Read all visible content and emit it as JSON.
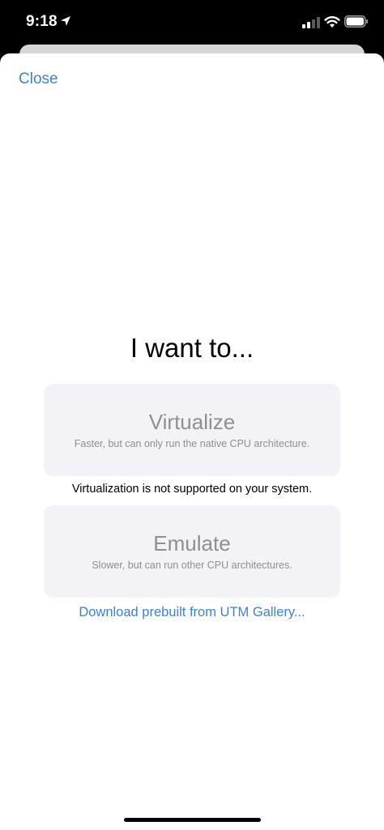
{
  "status_bar": {
    "time": "9:18",
    "icons": [
      "location-arrow-icon",
      "cellular-signal-icon",
      "wifi-icon",
      "battery-icon"
    ]
  },
  "sheet": {
    "close_label": "Close",
    "heading": "I want to...",
    "options": [
      {
        "title": "Virtualize",
        "subtitle": "Faster, but can only run the native CPU architecture.",
        "enabled": false
      },
      {
        "title": "Emulate",
        "subtitle": "Slower, but can run other CPU architectures.",
        "enabled": true
      }
    ],
    "notice": "Virtualization is not supported on your system.",
    "gallery_link": "Download prebuilt from UTM Gallery..."
  },
  "colors": {
    "accent": "#3b82d6",
    "card_background": "#f2f2f7",
    "secondary_text": "#8e8e93"
  }
}
